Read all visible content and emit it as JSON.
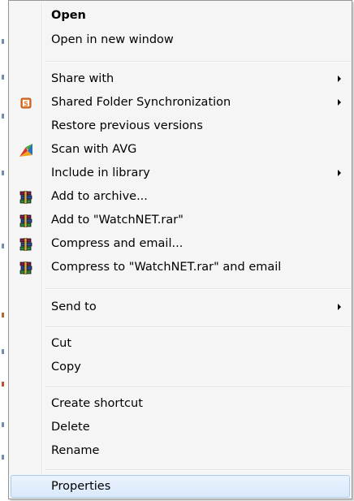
{
  "menu": {
    "open": "Open",
    "open_new_window": "Open in new window",
    "share_with": "Share with",
    "shared_folder_sync": "Shared Folder Synchronization",
    "restore_previous": "Restore previous versions",
    "scan_avg": "Scan with AVG",
    "include_library": "Include in library",
    "add_archive": "Add to archive...",
    "add_to_rar": "Add to \"WatchNET.rar\"",
    "compress_email": "Compress and email...",
    "compress_rar_email": "Compress to \"WatchNET.rar\" and email",
    "send_to": "Send to",
    "cut": "Cut",
    "copy": "Copy",
    "create_shortcut": "Create shortcut",
    "delete": "Delete",
    "rename": "Rename",
    "properties": "Properties"
  },
  "icons": {
    "shared_folder_sync": "sync-s-icon",
    "scan_avg": "avg-icon",
    "winrar": "winrar-books-icon"
  },
  "colors": {
    "menu_bg": "#f5f5f5",
    "hover_border": "#aaccee",
    "sync_icon": "#e8782a",
    "avg_red": "#d9302b",
    "avg_green": "#41a843",
    "avg_blue": "#2d6fbd",
    "avg_orange": "#f0a21e"
  }
}
